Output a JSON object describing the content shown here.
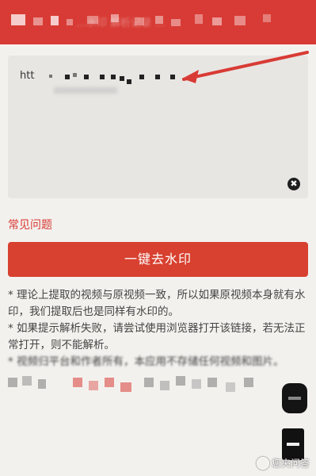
{
  "header": {
    "banner_text": "…水印 解析记录 …"
  },
  "input": {
    "prefix": "htt"
  },
  "clear_icon": {
    "glyph": "✖"
  },
  "faq": {
    "label": "常见问题"
  },
  "primary_action": {
    "label": "一键去水印"
  },
  "notes": [
    "* 理论上提取的视频与原视频一致，所以如果原视频本身就有水印，我们提取后也是同样有水印的。",
    "* 如果提示解析失败，请尝试使用浏览器打开该链接，若无法正常打开，则不能解析。",
    "* 视频归平台和作者所有，本应用不存储任何视频和图片。"
  ],
  "watermark": {
    "text": "您夹问答"
  },
  "colors": {
    "brand_red": "#d83b35",
    "button_red": "#d8402f",
    "background": "#f3f1ee",
    "input_bg": "#e8e6e3"
  }
}
